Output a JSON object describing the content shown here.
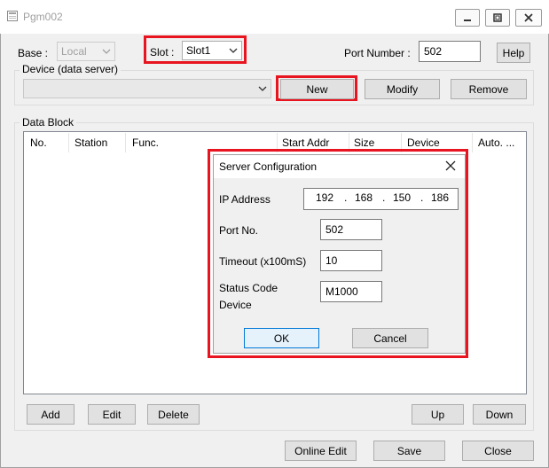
{
  "window": {
    "title": "Pgm002"
  },
  "top": {
    "base_label": "Base :",
    "base_value": "Local",
    "slot_label": "Slot :",
    "slot_value": "Slot1",
    "port_label": "Port Number :",
    "port_value": "502",
    "help_label": "Help"
  },
  "device": {
    "group_title": "Device (data server)",
    "combo_value": "",
    "new_label": "New",
    "modify_label": "Modify",
    "remove_label": "Remove"
  },
  "data_block": {
    "group_title": "Data Block",
    "columns": [
      "No.",
      "Station",
      "Func.",
      "Start Addr",
      "Size",
      "Device",
      "Auto. ..."
    ],
    "add_label": "Add",
    "edit_label": "Edit",
    "delete_label": "Delete",
    "up_label": "Up",
    "down_label": "Down"
  },
  "footer": {
    "online_edit_label": "Online Edit",
    "save_label": "Save",
    "close_label": "Close"
  },
  "dialog": {
    "title": "Server Configuration",
    "ip_label": "IP Address",
    "ip": [
      "192",
      "168",
      "150",
      "186"
    ],
    "ip_dot": ".",
    "port_label": "Port No.",
    "port_value": "502",
    "timeout_label": "Timeout (x100mS)",
    "timeout_value": "10",
    "status_label_line1": "Status Code",
    "status_label_line2": "Device",
    "status_value": "M1000",
    "ok_label": "OK",
    "cancel_label": "Cancel"
  },
  "colors": {
    "highlight": "#e8141f",
    "window_bg": "#f0f0f0",
    "button_bg": "#e1e1e1"
  }
}
